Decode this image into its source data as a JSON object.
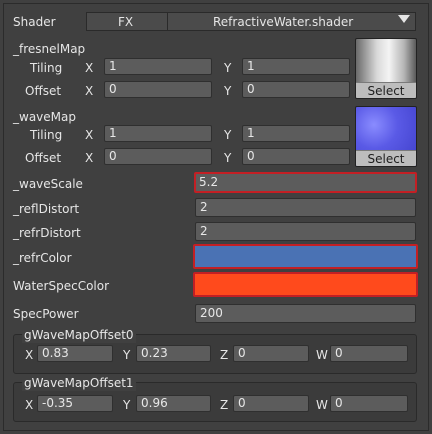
{
  "shader": {
    "label": "Shader",
    "fx_label": "FX",
    "selected": "RefractiveWater.shader",
    "dropdown_icon": "triangle-down-icon"
  },
  "textures": [
    {
      "name": "_fresnelMap",
      "tiling_label": "Tiling",
      "offset_label": "Offset",
      "tiling": {
        "x": "1",
        "y": "1"
      },
      "offset": {
        "x": "0",
        "y": "0"
      },
      "select_label": "Select"
    },
    {
      "name": "_waveMap",
      "tiling_label": "Tiling",
      "offset_label": "Offset",
      "tiling": {
        "x": "1",
        "y": "1"
      },
      "offset": {
        "x": "0",
        "y": "0"
      },
      "select_label": "Select"
    }
  ],
  "axis": {
    "x": "X",
    "y": "Y",
    "z": "Z",
    "w": "W"
  },
  "properties": {
    "wave_scale": {
      "label": "_waveScale",
      "value": "5.2"
    },
    "refl_distort": {
      "label": "_reflDistort",
      "value": "2"
    },
    "refr_distort": {
      "label": "_refrDistort",
      "value": "2"
    },
    "refr_color": {
      "label": "_refrColor",
      "color": "#4a72b4"
    },
    "water_spec_color": {
      "label": "WaterSpecColor",
      "color": "#ff4a1c"
    },
    "spec_power": {
      "label": "SpecPower",
      "value": "200"
    }
  },
  "vectors": [
    {
      "label": "gWaveMapOffset0",
      "x": "0.83",
      "y": "0.23",
      "z": "0",
      "w": "0"
    },
    {
      "label": "gWaveMapOffset1",
      "x": "-0.35",
      "y": "0.96",
      "z": "0",
      "w": "0"
    }
  ],
  "colors": {
    "highlight": "#c31f24",
    "background": "#404040",
    "field": "#5c5c5c"
  }
}
